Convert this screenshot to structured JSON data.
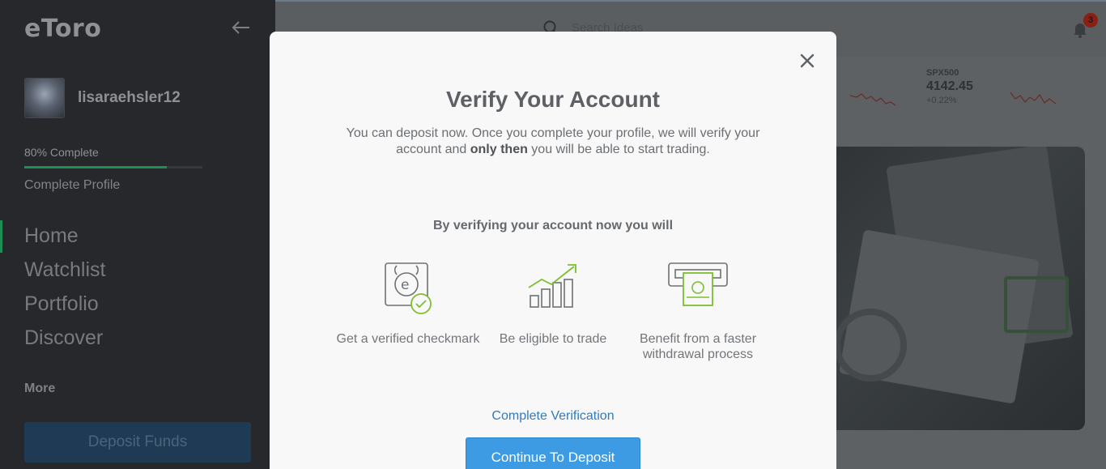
{
  "sidebar": {
    "logo": "eToro",
    "username": "lisaraehsler12",
    "progress": {
      "label": "80% Complete",
      "percent": 80
    },
    "complete_profile": "Complete Profile",
    "nav": [
      "Home",
      "Watchlist",
      "Portfolio",
      "Discover"
    ],
    "more": "More",
    "deposit_button": "Deposit Funds"
  },
  "topbar": {
    "search_placeholder": "Search Ideas",
    "notification_count": "3"
  },
  "ticker": {
    "symbol": "SPX500",
    "price": "4142.45",
    "change": "+0.22%"
  },
  "modal": {
    "title": "Verify Your Account",
    "desc_part1": "You can deposit now. Once you complete your profile, we will verify your account and ",
    "desc_bold": "only then",
    "desc_part2": " you will be able to start trading.",
    "benefits_heading": "By verifying your account now you will",
    "benefits": [
      {
        "label": "Get a verified checkmark",
        "icon": "verified-checkmark-icon"
      },
      {
        "label": "Be eligible to trade",
        "icon": "growth-chart-icon"
      },
      {
        "label": "Benefit from a faster withdrawal process",
        "icon": "atm-withdrawal-icon"
      }
    ],
    "complete_verification": "Complete Verification",
    "continue_button": "Continue To Deposit"
  },
  "colors": {
    "accent_blue": "#3c9be3",
    "link_blue": "#2f7bbd",
    "progress_green": "#1c8f54",
    "icon_green": "#7bbf2f"
  }
}
